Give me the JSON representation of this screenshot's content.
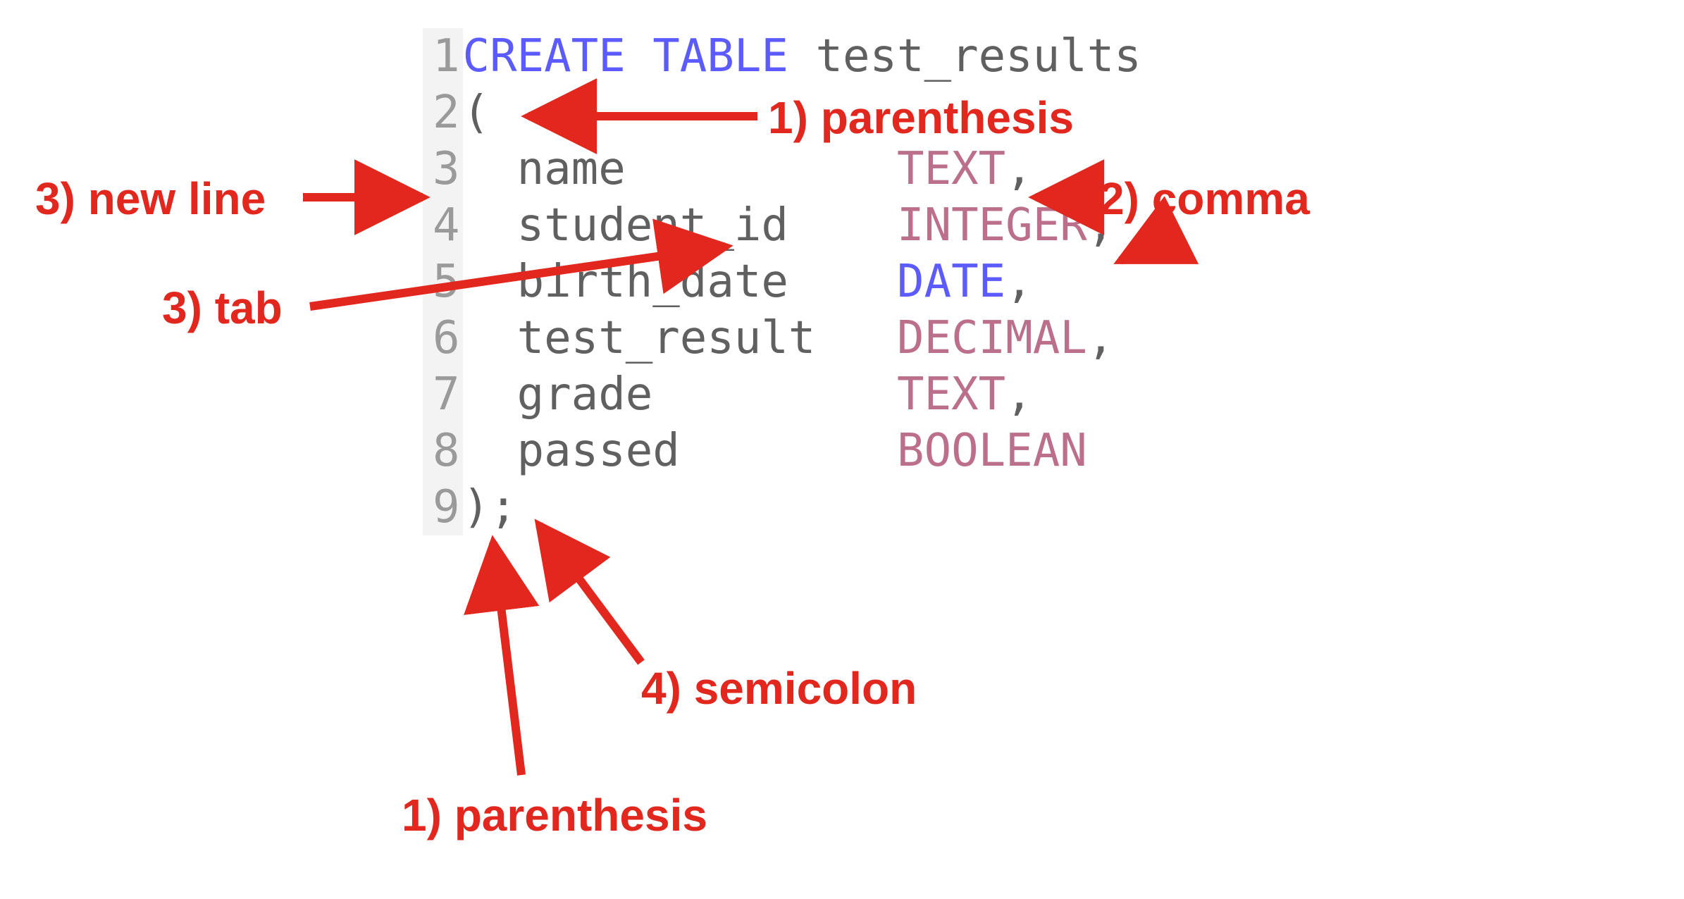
{
  "code": {
    "lines": [
      {
        "num": "1",
        "segments": [
          {
            "t": "CREATE TABLE",
            "c": "kw"
          },
          {
            "t": " ",
            "c": "id"
          },
          {
            "t": "test_results",
            "c": "id"
          }
        ]
      },
      {
        "num": "2",
        "segments": [
          {
            "t": "(",
            "c": "punc"
          }
        ]
      },
      {
        "num": "3",
        "segments": [
          {
            "t": "  name          ",
            "c": "id"
          },
          {
            "t": "TEXT",
            "c": "type"
          },
          {
            "t": ",",
            "c": "punc"
          }
        ]
      },
      {
        "num": "4",
        "segments": [
          {
            "t": "  student_id    ",
            "c": "id"
          },
          {
            "t": "INTEGER",
            "c": "type"
          },
          {
            "t": ",",
            "c": "punc"
          }
        ]
      },
      {
        "num": "5",
        "segments": [
          {
            "t": "  birth_date    ",
            "c": "id"
          },
          {
            "t": "DATE",
            "c": "kw"
          },
          {
            "t": ",",
            "c": "punc"
          }
        ]
      },
      {
        "num": "6",
        "segments": [
          {
            "t": "  test_result   ",
            "c": "id"
          },
          {
            "t": "DECIMAL",
            "c": "type"
          },
          {
            "t": ",",
            "c": "punc"
          }
        ]
      },
      {
        "num": "7",
        "segments": [
          {
            "t": "  grade         ",
            "c": "id"
          },
          {
            "t": "TEXT",
            "c": "type"
          },
          {
            "t": ",",
            "c": "punc"
          }
        ]
      },
      {
        "num": "8",
        "segments": [
          {
            "t": "  passed        ",
            "c": "id"
          },
          {
            "t": "BOOLEAN",
            "c": "type"
          }
        ]
      },
      {
        "num": "9",
        "segments": [
          {
            "t": ")",
            "c": "punc"
          },
          {
            "t": ";",
            "c": "punc"
          }
        ]
      }
    ]
  },
  "annotations": {
    "paren_top": "1) parenthesis",
    "comma": "2) comma",
    "newline": "3) new line",
    "tab": "3) tab",
    "semicolon": "4) semicolon",
    "paren_bottom": "1) parenthesis"
  },
  "colors": {
    "keyword": "#5b5bff",
    "type": "#bb6f8b",
    "identifier": "#606060",
    "annotation": "#e2281e",
    "gutter_bg": "#f3f3f3",
    "gutter_fg": "#9a9a9a"
  }
}
